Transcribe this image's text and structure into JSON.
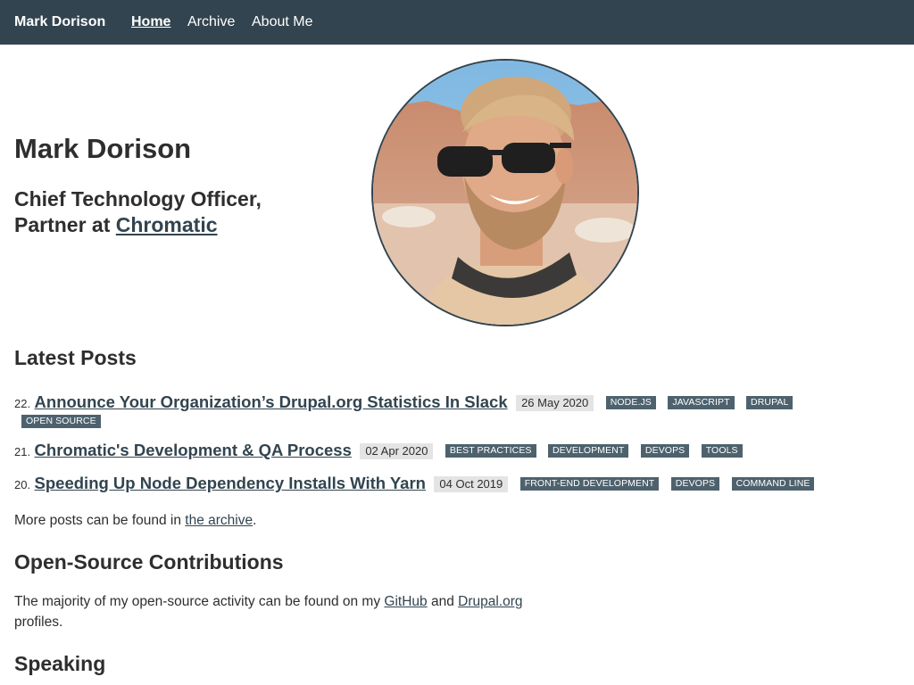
{
  "nav": {
    "brand": "Mark Dorison",
    "links": [
      "Home",
      "Archive",
      "About Me"
    ]
  },
  "hero": {
    "name": "Mark Dorison",
    "role_line1": "Chief Technology Officer,",
    "role_line2_prefix": "Partner at",
    "company": "Chromatic"
  },
  "latest_posts": {
    "heading": "Latest Posts",
    "posts": [
      {
        "number": "22.",
        "title": "Announce Your Organization’s Drupal.org Statistics In Slack",
        "date": "26 May 2020",
        "tags": [
          "NODE.JS",
          "JAVASCRIPT",
          "DRUPAL",
          "OPEN SOURCE"
        ]
      },
      {
        "number": "21.",
        "title": "Chromatic's Development & QA Process",
        "date": "02 Apr 2020",
        "tags": [
          "BEST PRACTICES",
          "DEVELOPMENT",
          "DEVOPS",
          "TOOLS"
        ]
      },
      {
        "number": "20.",
        "title": "Speeding Up Node Dependency Installs With Yarn",
        "date": "04 Oct 2019",
        "tags": [
          "FRONT-END DEVELOPMENT",
          "DEVOPS",
          "COMMAND LINE"
        ]
      }
    ],
    "more_prefix": "More posts can be found in",
    "more_link": "the archive",
    "more_suffix": "."
  },
  "open_source": {
    "heading": "Open-Source Contributions",
    "text_prefix": "The majority of my open-source activity can be found on my",
    "link_github": "GitHub",
    "text_and": "and",
    "link_drupal": "Drupal.org",
    "text_suffix": "profiles."
  },
  "speaking": {
    "heading": "Speaking"
  },
  "colors": {
    "navbar": "#32444f",
    "tag": "#4e626e",
    "date_badge": "#e4e4e4",
    "link": "#32444f"
  }
}
